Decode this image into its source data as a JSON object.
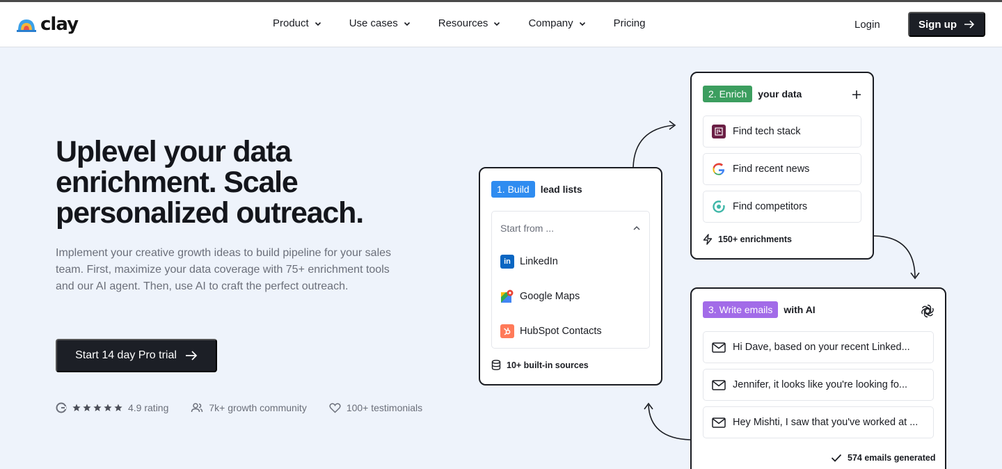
{
  "brand": {
    "name": "clay"
  },
  "nav": {
    "items": [
      {
        "label": "Product",
        "dropdown": true
      },
      {
        "label": "Use cases",
        "dropdown": true
      },
      {
        "label": "Resources",
        "dropdown": true
      },
      {
        "label": "Company",
        "dropdown": true
      },
      {
        "label": "Pricing",
        "dropdown": false
      }
    ],
    "login": "Login",
    "signup": "Sign up"
  },
  "hero": {
    "title": "Uplevel your data enrichment. Scale personalized outreach.",
    "subtitle": "Implement your creative growth ideas to build pipeline for your sales team. First, maximize your data coverage with 75+ enrichment tools and our AI agent. Then, use AI to craft the perfect outreach.",
    "cta": "Start 14 day Pro trial",
    "proof": {
      "rating": "4.9 rating",
      "stars": 5,
      "community": "7k+ growth community",
      "testimonials": "100+ testimonials"
    }
  },
  "build": {
    "tag": "1. Build",
    "heading": "lead lists",
    "select_placeholder": "Start from ...",
    "sources": [
      "LinkedIn",
      "Google Maps",
      "HubSpot Contacts"
    ],
    "footer": "10+ built-in sources",
    "tag_color": "#2f8cf0"
  },
  "enrich": {
    "tag": "2. Enrich",
    "heading": "your data",
    "items": [
      "Find tech stack",
      "Find recent news",
      "Find competitors"
    ],
    "footer": "150+ enrichments",
    "tag_color": "#3c9e5f"
  },
  "write": {
    "tag": "3. Write emails",
    "heading": "with AI",
    "emails": [
      "Hi Dave, based on your recent Linked...",
      "Jennifer, it looks like you're looking fo...",
      "Hey Mishti, I saw that you've worked at ..."
    ],
    "footer": "574 emails generated",
    "tag_color": "#a26be8"
  }
}
